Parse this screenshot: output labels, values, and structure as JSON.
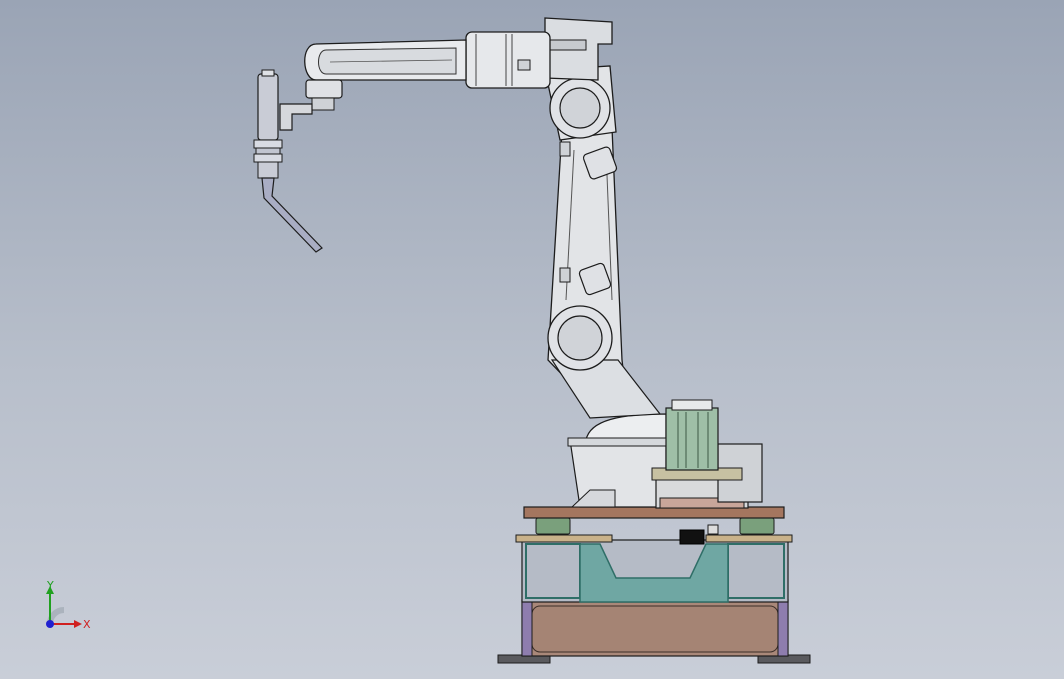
{
  "viewport": {
    "background_top": "#9aa4b5",
    "background_bottom": "#c9ced8"
  },
  "model": {
    "kind": "robot-arm-welding-assembly",
    "colors": {
      "robot_body": "#e2e4e7",
      "robot_shade": "#c2c5ca",
      "outline": "#1c1c1c",
      "motor": "#9fbfa7",
      "platform_top": "#a4765f",
      "frame_fill": "#6fa7a3",
      "frame_edge": "#2f6e67",
      "base_block": "#a98879",
      "rail_green": "#7aa07c",
      "feet": "#5a5a5e",
      "torch": "#a9adc4"
    }
  },
  "triad": {
    "x_label": "X",
    "y_label": "Y",
    "x_color": "#d02020",
    "y_color": "#20a020",
    "z_color": "#2020d0"
  }
}
